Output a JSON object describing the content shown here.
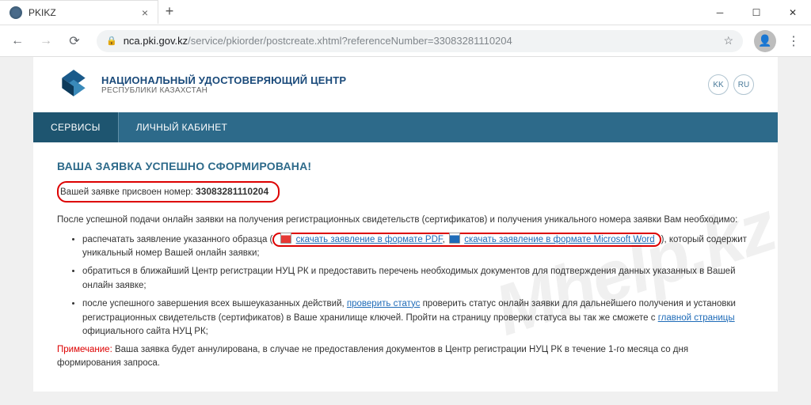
{
  "browser": {
    "tab_title": "PKIKZ",
    "url_host": "nca.pki.gov.kz",
    "url_path": "/service/pkiorder/postcreate.xhtml?referenceNumber=33083281110204"
  },
  "header": {
    "org_title": "НАЦИОНАЛЬНЫЙ УДОСТОВЕРЯЮЩИЙ ЦЕНТР",
    "org_sub": "РЕСПУБЛИКИ КАЗАХСТАН",
    "lang": {
      "kk": "KK",
      "ru": "RU"
    }
  },
  "nav": {
    "services": "СЕРВИСЫ",
    "cabinet": "ЛИЧНЫЙ КАБИНЕТ"
  },
  "content": {
    "success_title": "ВАША ЗАЯВКА УСПЕШНО СФОРМИРОВАНА!",
    "ref_label": "Вашей заявке присвоен номер: ",
    "ref_number": "33083281110204",
    "intro": "После успешной подачи онлайн заявки на получения регистрационных свидетельств (сертификатов) и получения уникального номера заявки Вам необходимо:",
    "steps": [
      {
        "pre": "распечатать заявление указанного образца (",
        "pdf_link": "скачать заявление в формате PDF",
        "sep": ", ",
        "doc_link": "скачать заявление в формате Microsoft Word",
        "post": "), который содержит уникальный номер Вашей онлайн заявки;"
      },
      {
        "text": "обратиться в ближайший Центр регистрации НУЦ РК и предоставить перечень необходимых документов для подтверждения данных указанных в Вашей онлайн заявке;"
      },
      {
        "pre": "после успешного завершения всех вышеуказанных действий, ",
        "link": "проверить статус",
        "mid": " проверить статус онлайн заявки для дальнейшего получения и установки регистрационных свидетельств (сертификатов) в Ваше хранилище ключей. Пройти на страницу проверки статуса вы так же сможете с ",
        "link2": "главной страницы",
        "post": " официального сайта НУЦ РК;"
      }
    ],
    "note_label": "Примечание:",
    "note_text": " Ваша заявка будет аннулирована, в случае не предоставления документов в Центр регистрации НУЦ РК в течение 1-го месяца со дня формирования запроса."
  },
  "watermark": "Mhelp.kz"
}
